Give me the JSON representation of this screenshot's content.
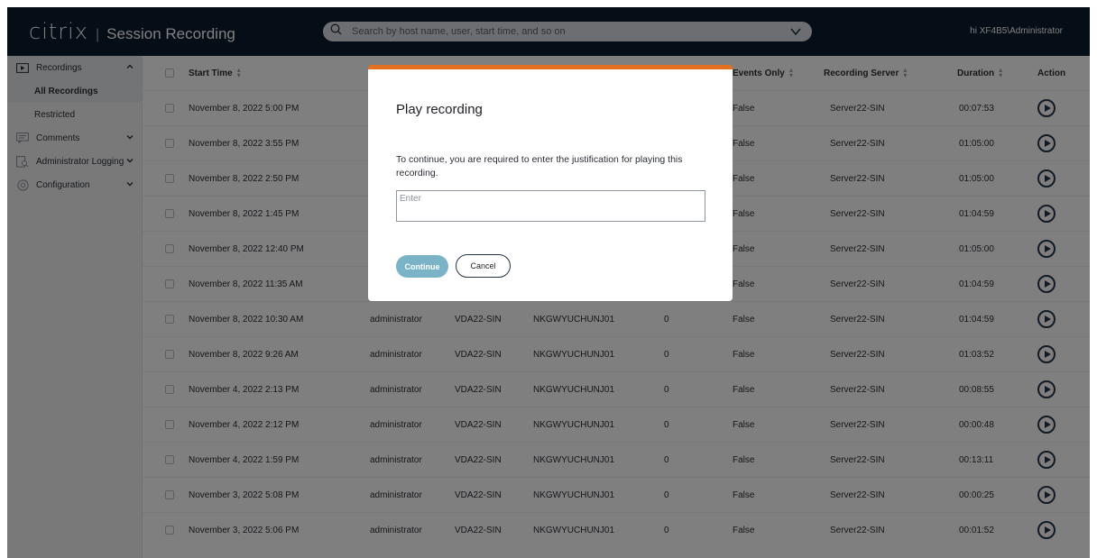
{
  "header": {
    "logo_text": "citrix",
    "separator": "|",
    "product": "Session Recording",
    "search_placeholder": "Search by host name, user, start time, and so on",
    "user": "hi XF4B5\\Administrator"
  },
  "sidebar": {
    "recordings": "Recordings",
    "all_recordings": "All Recordings",
    "restricted": "Restricted",
    "comments": "Comments",
    "admin_logging": "Administrator Logging",
    "configuration": "Configuration"
  },
  "table": {
    "headers": {
      "start_time": "Start Time",
      "events_only": "Events Only",
      "recording_server": "Recording Server",
      "duration": "Duration",
      "action": "Action"
    },
    "rows": [
      {
        "start": "November 8, 2022 5:00 PM",
        "user": "",
        "host": "",
        "client": "",
        "count": "",
        "events": "False",
        "server": "Server22-SIN",
        "duration": "00:07:53"
      },
      {
        "start": "November 8, 2022 3:55 PM",
        "user": "",
        "host": "",
        "client": "",
        "count": "",
        "events": "False",
        "server": "Server22-SIN",
        "duration": "01:05:00"
      },
      {
        "start": "November 8, 2022 2:50 PM",
        "user": "",
        "host": "",
        "client": "",
        "count": "",
        "events": "False",
        "server": "Server22-SIN",
        "duration": "01:05:00"
      },
      {
        "start": "November 8, 2022 1:45 PM",
        "user": "",
        "host": "",
        "client": "",
        "count": "",
        "events": "False",
        "server": "Server22-SIN",
        "duration": "01:04:59"
      },
      {
        "start": "November 8, 2022 12:40 PM",
        "user": "",
        "host": "",
        "client": "",
        "count": "",
        "events": "False",
        "server": "Server22-SIN",
        "duration": "01:05:00"
      },
      {
        "start": "November 8, 2022 11:35 AM",
        "user": "",
        "host": "",
        "client": "",
        "count": "",
        "events": "False",
        "server": "Server22-SIN",
        "duration": "01:04:59"
      },
      {
        "start": "November 8, 2022 10:30 AM",
        "user": "administrator",
        "host": "VDA22-SIN",
        "client": "NKGWYUCHUNJ01",
        "count": "0",
        "events": "False",
        "server": "Server22-SIN",
        "duration": "01:04:59"
      },
      {
        "start": "November 8, 2022 9:26 AM",
        "user": "administrator",
        "host": "VDA22-SIN",
        "client": "NKGWYUCHUNJ01",
        "count": "0",
        "events": "False",
        "server": "Server22-SIN",
        "duration": "01:03:52"
      },
      {
        "start": "November 4, 2022 2:13 PM",
        "user": "administrator",
        "host": "VDA22-SIN",
        "client": "NKGWYUCHUNJ01",
        "count": "0",
        "events": "False",
        "server": "Server22-SIN",
        "duration": "00:08:55"
      },
      {
        "start": "November 4, 2022 2:12 PM",
        "user": "administrator",
        "host": "VDA22-SIN",
        "client": "NKGWYUCHUNJ01",
        "count": "0",
        "events": "False",
        "server": "Server22-SIN",
        "duration": "00:00:48"
      },
      {
        "start": "November 4, 2022 1:59 PM",
        "user": "administrator",
        "host": "VDA22-SIN",
        "client": "NKGWYUCHUNJ01",
        "count": "0",
        "events": "False",
        "server": "Server22-SIN",
        "duration": "00:13:11"
      },
      {
        "start": "November 3, 2022 5:08 PM",
        "user": "administrator",
        "host": "VDA22-SIN",
        "client": "NKGWYUCHUNJ01",
        "count": "0",
        "events": "False",
        "server": "Server22-SIN",
        "duration": "00:00:25"
      },
      {
        "start": "November 3, 2022 5:06 PM",
        "user": "administrator",
        "host": "VDA22-SIN",
        "client": "NKGWYUCHUNJ01",
        "count": "0",
        "events": "False",
        "server": "Server22-SIN",
        "duration": "00:01:52"
      }
    ]
  },
  "dialog": {
    "title": "Play recording",
    "message": "To continue, you are required to enter the justification for playing this recording.",
    "input_placeholder": "Enter",
    "continue_label": "Continue",
    "cancel_label": "Cancel"
  },
  "colors": {
    "header_bg": "#0b1a2d",
    "dialog_accent": "#e3701e",
    "continue_button": "#7ab3c8"
  }
}
